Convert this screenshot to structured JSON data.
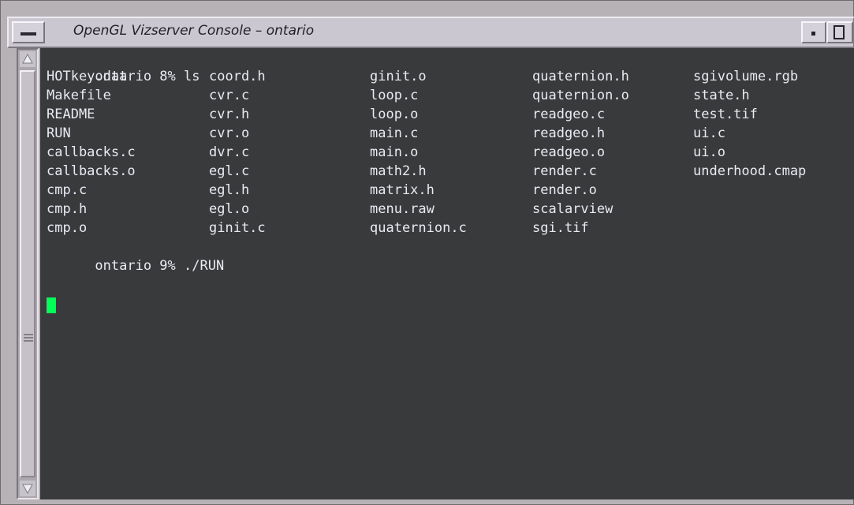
{
  "window": {
    "title": "OpenGL Vizserver Console – ontario"
  },
  "terminal": {
    "prompt_ls": "ontario 8% ls",
    "ls_rows": [
      [
        "HOTkey.dat",
        "coord.h",
        "ginit.o",
        "quaternion.h",
        "sgivolume.rgb"
      ],
      [
        "Makefile",
        "cvr.c",
        "loop.c",
        "quaternion.o",
        "state.h"
      ],
      [
        "README",
        "cvr.h",
        "loop.o",
        "readgeo.c",
        "test.tif"
      ],
      [
        "RUN",
        "cvr.o",
        "main.c",
        "readgeo.h",
        "ui.c"
      ],
      [
        "callbacks.c",
        "dvr.c",
        "main.o",
        "readgeo.o",
        "ui.o"
      ],
      [
        "callbacks.o",
        "egl.c",
        "math2.h",
        "render.c",
        "underhood.cmap"
      ],
      [
        "cmp.c",
        "egl.h",
        "matrix.h",
        "render.o",
        ""
      ],
      [
        "cmp.h",
        "egl.o",
        "menu.raw",
        "scalarview",
        ""
      ],
      [
        "cmp.o",
        "ginit.c",
        "quaternion.c",
        "sgi.tif",
        ""
      ]
    ],
    "prompt_run": "ontario 9% ./RUN",
    "cursor_color": "#00ff57",
    "background_color": "#393a3c",
    "text_color": "#e9eaf2"
  },
  "icons": {
    "menu": "window-menu-icon",
    "minimize": "minimize-icon",
    "maximize": "maximize-icon",
    "scroll_up": "scroll-up-arrow-icon",
    "scroll_down": "scroll-down-arrow-icon",
    "grip": "scroll-grip-icon"
  }
}
